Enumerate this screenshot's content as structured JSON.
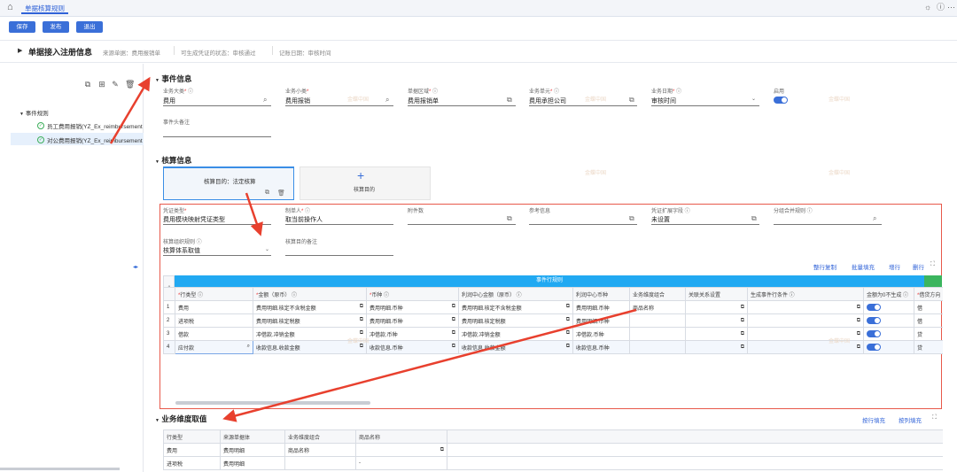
{
  "app": {
    "tab_title": "单据核算规则"
  },
  "toolbar": {
    "save": "保存",
    "publish": "发布",
    "exit": "退出"
  },
  "info": {
    "title": "单据接入注册信息",
    "source": "来源单据：费用报销单",
    "state": "可生成凭证的状态：审核通过",
    "date": "记账日期：审核时间"
  },
  "tree": {
    "root": "事件规则",
    "items": [
      {
        "label": "员工费用报销(YZ_Ex_reimbursement"
      },
      {
        "label": "对公费用报销(YZ_Ex_reimbursement"
      }
    ]
  },
  "event": {
    "section": "事件信息",
    "fields": [
      {
        "label": "业务大类",
        "required": true,
        "value": "费用",
        "icon": "search-icon"
      },
      {
        "label": "业务小类",
        "required": true,
        "value": "费用报销",
        "icon": "search-icon"
      },
      {
        "label": "单据区域",
        "required": true,
        "value": "费用报销单",
        "icon": "copy-icon"
      },
      {
        "label": "业务单元",
        "required": true,
        "value": "费用承担公司",
        "icon": "copy-icon"
      },
      {
        "label": "业务日期",
        "required": true,
        "value": "审核时间",
        "icon": "chevron-down-icon"
      },
      {
        "label": "启用",
        "required": false,
        "value": "",
        "icon": "toggle"
      }
    ],
    "remark_label": "事件头备注"
  },
  "accounting": {
    "section": "核算信息",
    "card_title": "核算目的：法定核算",
    "add_label": "核算目的",
    "fields": [
      {
        "label": "凭证类型",
        "required": true,
        "value": "费用模块映射凭证类型"
      },
      {
        "label": "制单人",
        "required": true,
        "value": "取当前操作人"
      },
      {
        "label": "附件数",
        "required": false,
        "value": ""
      },
      {
        "label": "参考信息",
        "required": false,
        "value": ""
      },
      {
        "label": "凭证扩展字段",
        "required": false,
        "value": "未设置"
      },
      {
        "label": "分组合并规则",
        "required": false,
        "value": ""
      }
    ],
    "org_label": "核算组织规则",
    "org_value": "核算体系取值",
    "purpose_remark": "核算目的备注"
  },
  "actions": {
    "copy_row": "整行复制",
    "batch_fill": "批量填充",
    "add_row": "增行",
    "delete_row": "删行"
  },
  "entry_table": {
    "group_title": "事件行规则",
    "headers": [
      "行类型",
      "金额（原币）",
      "币种",
      "利润中心金额（原币）",
      "利润中心币种",
      "业务维度组合",
      "关联关系设置",
      "生成事件行条件",
      "金额为0不生成",
      "借贷方向"
    ],
    "rows": [
      {
        "n": "1",
        "type": "费用",
        "amount": "费用明细.核定不含税金额",
        "currency": "费用明细.币种",
        "pc_amount": "费用明细.核定不含税金额",
        "pc_currency": "费用明细.币种",
        "dim": "商品名称",
        "dir": "借"
      },
      {
        "n": "2",
        "type": "进项税",
        "amount": "费用明细.核定税额",
        "currency": "费用明细.币种",
        "pc_amount": "费用明细.核定税额",
        "pc_currency": "费用明细.币种",
        "dim": "",
        "dir": "借"
      },
      {
        "n": "3",
        "type": "借款",
        "amount": "冲借款.冲销金额",
        "currency": "冲借款.币种",
        "pc_amount": "冲借款.冲销金额",
        "pc_currency": "冲借款.币种",
        "dim": "",
        "dir": "贷"
      },
      {
        "n": "4",
        "type": "应付款",
        "amount": "收款信息.收款金额",
        "currency": "收款信息.币种",
        "pc_amount": "收款信息.收款金额",
        "pc_currency": "收款信息.币种",
        "dim": "",
        "dir": "贷"
      }
    ]
  },
  "dimension": {
    "section": "业务维度取值",
    "fill_row": "按行填充",
    "fill_col": "按列填充",
    "headers": [
      "行类型",
      "来源单据体",
      "业务维度组合",
      "商品名称"
    ],
    "rows": [
      {
        "type": "费用",
        "source": "费用明细",
        "combo": "商品名称",
        "name": ""
      },
      {
        "type": "进项税",
        "source": "费用明细",
        "combo": "",
        "name": "-"
      }
    ]
  },
  "watermark": "金蝶中国"
}
